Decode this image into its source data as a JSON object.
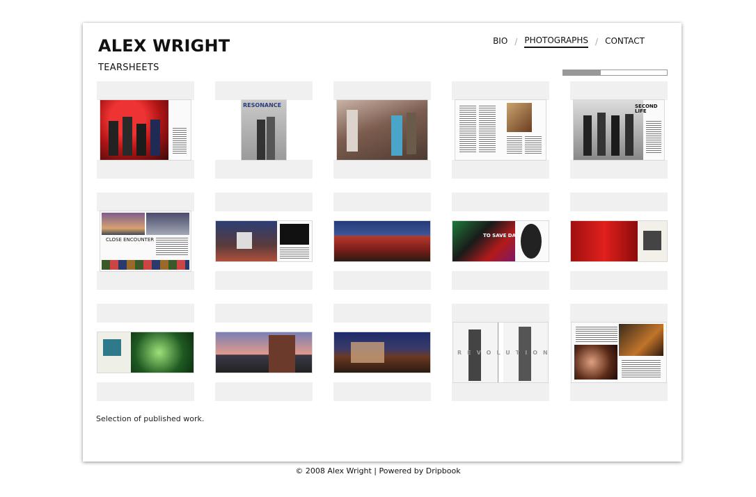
{
  "site": {
    "title": "ALEX WRIGHT"
  },
  "section": {
    "title": "TEARSHEETS"
  },
  "nav": {
    "items": [
      {
        "label": "BIO",
        "active": false
      },
      {
        "label": "PHOTOGRAPHS",
        "active": true
      },
      {
        "label": "CONTACT",
        "active": false
      }
    ],
    "separator": "/"
  },
  "loader": {
    "progress": 0.36
  },
  "gallery": {
    "thumbnails": [
      {
        "text": ""
      },
      {
        "text": "RESONANCE"
      },
      {
        "text": ""
      },
      {
        "text": ""
      },
      {
        "text": "SECOND LIFE"
      },
      {
        "text": "CLOSE ENCOUNTER"
      },
      {
        "text": ""
      },
      {
        "text": ""
      },
      {
        "text": "TO SAVE DA..."
      },
      {
        "text": ""
      },
      {
        "text": ""
      },
      {
        "text": ""
      },
      {
        "text": ""
      },
      {
        "text": "REVOLUTION"
      },
      {
        "text": ""
      }
    ]
  },
  "description": "Selection of published work.",
  "footer": {
    "text": "© 2008 Alex Wright | Powered by Dripbook"
  }
}
